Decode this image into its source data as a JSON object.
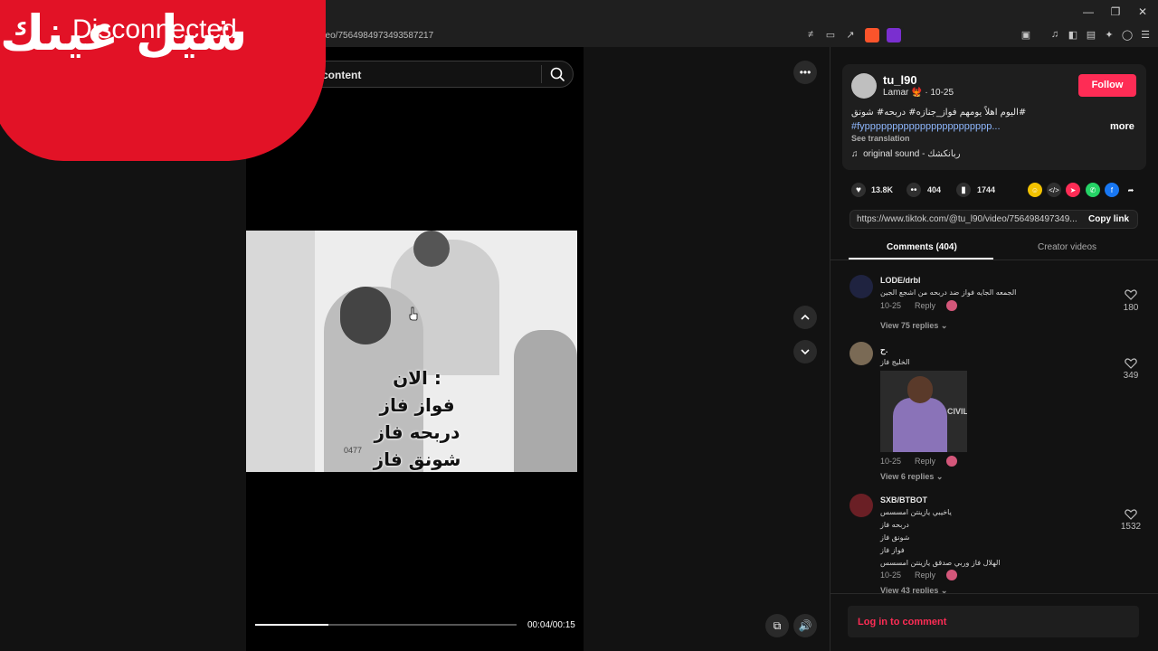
{
  "browser": {
    "url": "tiktok.com/@tu_l90/video/7564984973493587217",
    "url_visible": "/video/7564984973493587217"
  },
  "overlay": {
    "arabic_text": "شيل عينك",
    "status_text": "Disconnected",
    "banner_color": "#e21226"
  },
  "search": {
    "value": "content",
    "icon": "search-icon"
  },
  "video": {
    "caption_lines": [
      "الان :",
      "فواز فاز",
      "دربحه فاز",
      "شونق فاز"
    ],
    "watermark": "0477",
    "current_time": "00:04",
    "duration": "00:15",
    "time_display": "00:04/00:15",
    "progress_fraction": 0.28
  },
  "post": {
    "username": "tu_l90",
    "nickname": "Lamar 🐦‍🔥",
    "date": "10-25",
    "follow_label": "Follow",
    "caption_line1": "اليوم اهلاً يومهم فواز_جنازه# دربحه# شونق#",
    "caption_line2": "#fyppppppppppppppppppppppp...",
    "more_label": "more",
    "see_translation": "See translation",
    "sound": "original sound - ربانكشك"
  },
  "stats": {
    "likes": "13.8K",
    "comments": "404",
    "saves": "1744"
  },
  "share": {
    "link": "https://www.tiktok.com/@tu_l90/video/756498497349...",
    "copy_label": "Copy link"
  },
  "tabs": [
    {
      "label": "Comments (404)",
      "active": true
    },
    {
      "label": "Creator videos",
      "active": false
    }
  ],
  "comments": [
    {
      "user": "LODE/drbl",
      "text_lines": [
        "الجمعه الجايه فواز ضد دربحه من اشجع الجين"
      ],
      "date": "10-25",
      "reply_label": "Reply",
      "view_replies": "View 75 replies",
      "likes": "180"
    },
    {
      "user": "ح.",
      "text_lines": [
        "الخليج فاز"
      ],
      "has_image": true,
      "image_text": "CIVIL",
      "date": "10-25",
      "reply_label": "Reply",
      "view_replies": "View 6 replies",
      "likes": "349"
    },
    {
      "user": "SXB/BTBOT",
      "text_lines": [
        "ياخيبي يازينتن امسسس",
        "دربحه فاز",
        "شونق فاز",
        "فواز فاز",
        "الهلال فاز وربي صدقق يازينتن امسسس"
      ],
      "date": "10-25",
      "reply_label": "Reply",
      "view_replies": "View 43 replies",
      "likes": "1532"
    }
  ],
  "login": {
    "label": "Log in to comment"
  },
  "colors": {
    "accent": "#fe2c55",
    "hashtag": "#8fb8ff"
  }
}
